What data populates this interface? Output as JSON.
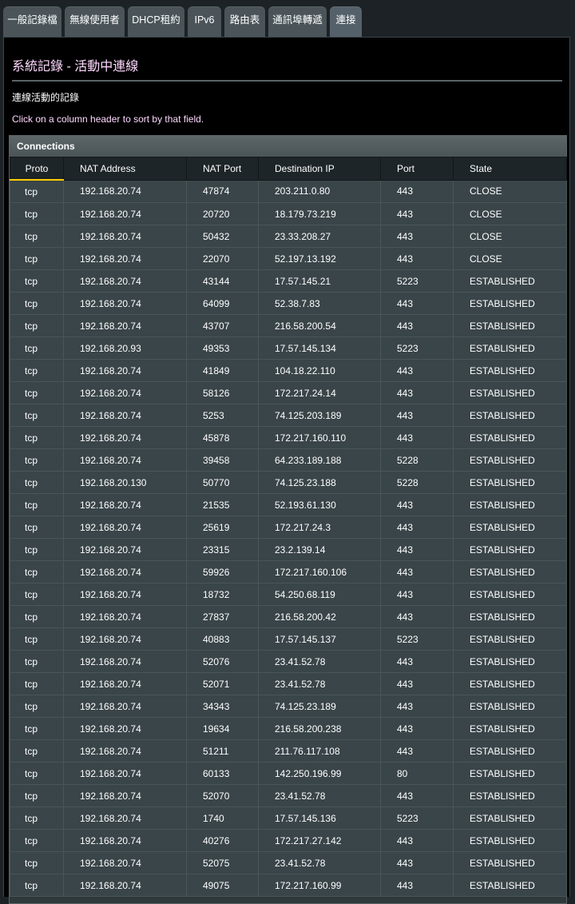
{
  "tabs": [
    {
      "label": "一般記錄檔"
    },
    {
      "label": "無線使用者"
    },
    {
      "label": "DHCP租約"
    },
    {
      "label": "IPv6"
    },
    {
      "label": "路由表"
    },
    {
      "label": "通訊埠轉遞"
    },
    {
      "label": "連接"
    }
  ],
  "page": {
    "title": "系統記錄 - 活動中連線",
    "description": "連線活動的記錄",
    "hint": "Click on a column header to sort by that field."
  },
  "connections": {
    "title": "Connections",
    "columns": [
      "Proto",
      "NAT Address",
      "NAT Port",
      "Destination IP",
      "Port",
      "State"
    ],
    "rows": [
      [
        "tcp",
        "192.168.20.74",
        "47874",
        "203.211.0.80",
        "443",
        "CLOSE"
      ],
      [
        "tcp",
        "192.168.20.74",
        "20720",
        "18.179.73.219",
        "443",
        "CLOSE"
      ],
      [
        "tcp",
        "192.168.20.74",
        "50432",
        "23.33.208.27",
        "443",
        "CLOSE"
      ],
      [
        "tcp",
        "192.168.20.74",
        "22070",
        "52.197.13.192",
        "443",
        "CLOSE"
      ],
      [
        "tcp",
        "192.168.20.74",
        "43144",
        "17.57.145.21",
        "5223",
        "ESTABLISHED"
      ],
      [
        "tcp",
        "192.168.20.74",
        "64099",
        "52.38.7.83",
        "443",
        "ESTABLISHED"
      ],
      [
        "tcp",
        "192.168.20.74",
        "43707",
        "216.58.200.54",
        "443",
        "ESTABLISHED"
      ],
      [
        "tcp",
        "192.168.20.93",
        "49353",
        "17.57.145.134",
        "5223",
        "ESTABLISHED"
      ],
      [
        "tcp",
        "192.168.20.74",
        "41849",
        "104.18.22.110",
        "443",
        "ESTABLISHED"
      ],
      [
        "tcp",
        "192.168.20.74",
        "58126",
        "172.217.24.14",
        "443",
        "ESTABLISHED"
      ],
      [
        "tcp",
        "192.168.20.74",
        "5253",
        "74.125.203.189",
        "443",
        "ESTABLISHED"
      ],
      [
        "tcp",
        "192.168.20.74",
        "45878",
        "172.217.160.110",
        "443",
        "ESTABLISHED"
      ],
      [
        "tcp",
        "192.168.20.74",
        "39458",
        "64.233.189.188",
        "5228",
        "ESTABLISHED"
      ],
      [
        "tcp",
        "192.168.20.130",
        "50770",
        "74.125.23.188",
        "5228",
        "ESTABLISHED"
      ],
      [
        "tcp",
        "192.168.20.74",
        "21535",
        "52.193.61.130",
        "443",
        "ESTABLISHED"
      ],
      [
        "tcp",
        "192.168.20.74",
        "25619",
        "172.217.24.3",
        "443",
        "ESTABLISHED"
      ],
      [
        "tcp",
        "192.168.20.74",
        "23315",
        "23.2.139.14",
        "443",
        "ESTABLISHED"
      ],
      [
        "tcp",
        "192.168.20.74",
        "59926",
        "172.217.160.106",
        "443",
        "ESTABLISHED"
      ],
      [
        "tcp",
        "192.168.20.74",
        "18732",
        "54.250.68.119",
        "443",
        "ESTABLISHED"
      ],
      [
        "tcp",
        "192.168.20.74",
        "27837",
        "216.58.200.42",
        "443",
        "ESTABLISHED"
      ],
      [
        "tcp",
        "192.168.20.74",
        "40883",
        "17.57.145.137",
        "5223",
        "ESTABLISHED"
      ],
      [
        "tcp",
        "192.168.20.74",
        "52076",
        "23.41.52.78",
        "443",
        "ESTABLISHED"
      ],
      [
        "tcp",
        "192.168.20.74",
        "52071",
        "23.41.52.78",
        "443",
        "ESTABLISHED"
      ],
      [
        "tcp",
        "192.168.20.74",
        "34343",
        "74.125.23.189",
        "443",
        "ESTABLISHED"
      ],
      [
        "tcp",
        "192.168.20.74",
        "19634",
        "216.58.200.238",
        "443",
        "ESTABLISHED"
      ],
      [
        "tcp",
        "192.168.20.74",
        "51211",
        "211.76.117.108",
        "443",
        "ESTABLISHED"
      ],
      [
        "tcp",
        "192.168.20.74",
        "60133",
        "142.250.196.99",
        "80",
        "ESTABLISHED"
      ],
      [
        "tcp",
        "192.168.20.74",
        "52070",
        "23.41.52.78",
        "443",
        "ESTABLISHED"
      ],
      [
        "tcp",
        "192.168.20.74",
        "1740",
        "17.57.145.136",
        "5223",
        "ESTABLISHED"
      ],
      [
        "tcp",
        "192.168.20.74",
        "40276",
        "172.217.27.142",
        "443",
        "ESTABLISHED"
      ],
      [
        "tcp",
        "192.168.20.74",
        "52075",
        "23.41.52.78",
        "443",
        "ESTABLISHED"
      ],
      [
        "tcp",
        "192.168.20.74",
        "49075",
        "172.217.160.99",
        "443",
        "ESTABLISHED"
      ]
    ]
  }
}
